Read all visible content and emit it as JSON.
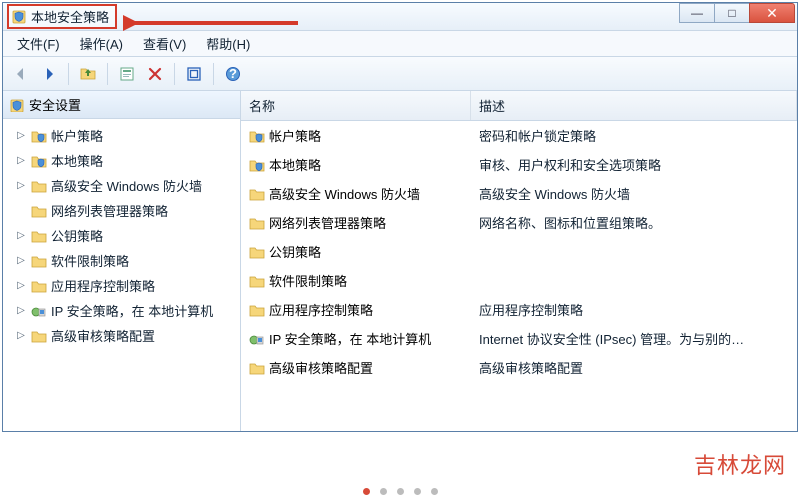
{
  "window": {
    "title": "本地安全策略"
  },
  "menubar": {
    "file": "文件(F)",
    "action": "操作(A)",
    "view": "查看(V)",
    "help": "帮助(H)"
  },
  "toolbar": {
    "back": "back-icon",
    "forward": "forward-icon",
    "up": "up-icon",
    "delete": "delete-icon",
    "refresh": "refresh-icon",
    "help": "help-icon"
  },
  "tree": {
    "root": "安全设置",
    "items": [
      {
        "label": "帐户策略"
      },
      {
        "label": "本地策略"
      },
      {
        "label": "高级安全 Windows 防火墙"
      },
      {
        "label": "网络列表管理器策略"
      },
      {
        "label": "公钥策略"
      },
      {
        "label": "软件限制策略"
      },
      {
        "label": "应用程序控制策略"
      },
      {
        "label": "IP 安全策略，在 本地计算机"
      },
      {
        "label": "高级审核策略配置"
      }
    ]
  },
  "list": {
    "columns": {
      "name": "名称",
      "desc": "描述"
    },
    "rows": [
      {
        "icon": "shield-folder",
        "name": "帐户策略",
        "desc": "密码和帐户锁定策略"
      },
      {
        "icon": "shield-folder",
        "name": "本地策略",
        "desc": "审核、用户权利和安全选项策略"
      },
      {
        "icon": "folder",
        "name": "高级安全 Windows 防火墙",
        "desc": "高级安全 Windows 防火墙"
      },
      {
        "icon": "folder",
        "name": "网络列表管理器策略",
        "desc": "网络名称、图标和位置组策略。"
      },
      {
        "icon": "folder",
        "name": "公钥策略",
        "desc": ""
      },
      {
        "icon": "folder",
        "name": "软件限制策略",
        "desc": ""
      },
      {
        "icon": "folder",
        "name": "应用程序控制策略",
        "desc": "应用程序控制策略"
      },
      {
        "icon": "ipsec",
        "name": "IP 安全策略，在 本地计算机",
        "desc": "Internet 协议安全性 (IPsec) 管理。为与别的…"
      },
      {
        "icon": "folder",
        "name": "高级审核策略配置",
        "desc": "高级审核策略配置"
      }
    ]
  },
  "watermark": "吉林龙网"
}
